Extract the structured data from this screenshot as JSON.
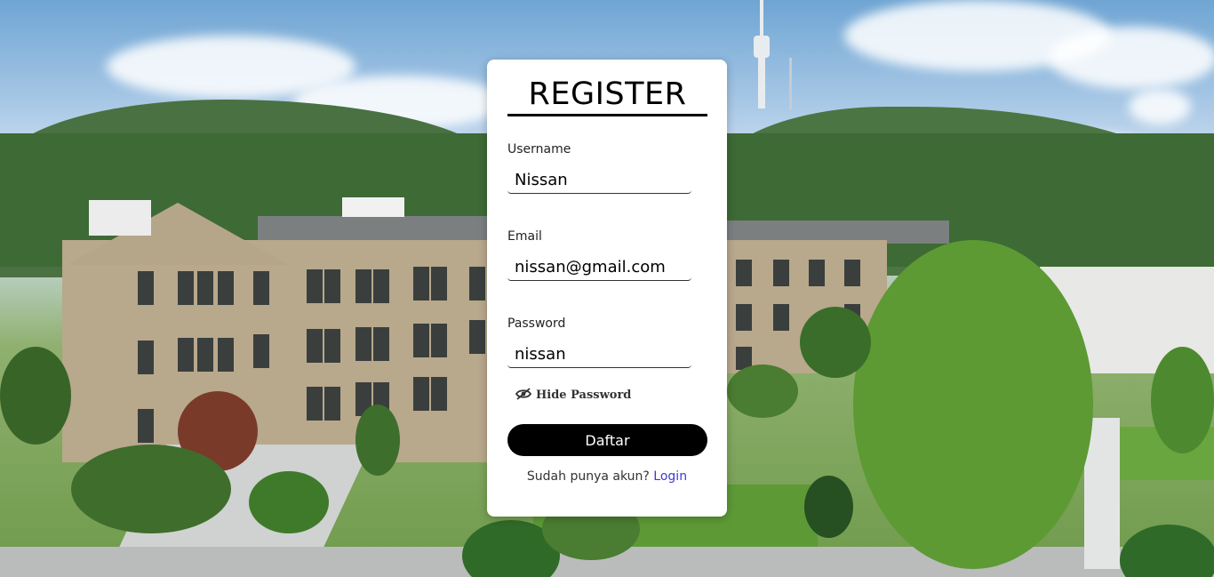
{
  "form": {
    "title": "REGISTER",
    "username_label": "Username",
    "username_value": "Nissan",
    "email_label": "Email",
    "email_value": "nissan@gmail.com",
    "password_label": "Password",
    "password_value": "nissan",
    "toggle_icon": "eye-slash-icon",
    "toggle_label": "Hide Password",
    "submit_label": "Daftar",
    "footer_text": "Sudah punya akun?",
    "login_link": "Login"
  },
  "colors": {
    "card_bg": "#ffffff",
    "button_bg": "#000000",
    "button_text": "#ffffff",
    "link": "#3b3bd6"
  }
}
